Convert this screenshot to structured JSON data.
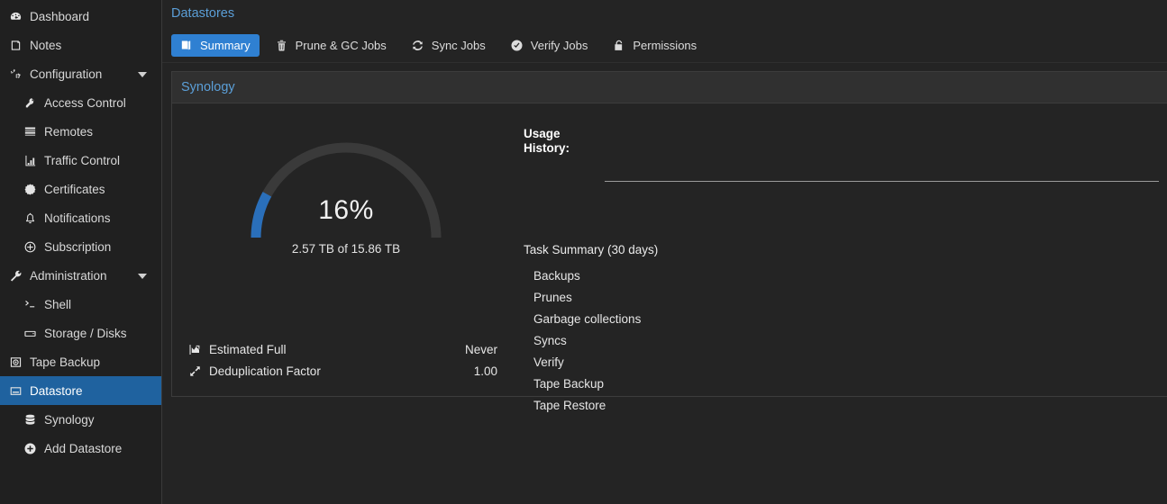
{
  "sidebar": {
    "items": [
      {
        "label": "Dashboard",
        "icon": "gauge-icon",
        "level": 0,
        "selected": false,
        "caret": false
      },
      {
        "label": "Notes",
        "icon": "note-icon",
        "level": 0,
        "selected": false,
        "caret": false
      },
      {
        "label": "Configuration",
        "icon": "gears-icon",
        "level": 0,
        "selected": false,
        "caret": true
      },
      {
        "label": "Access Control",
        "icon": "key-icon",
        "level": 1,
        "selected": false,
        "caret": false
      },
      {
        "label": "Remotes",
        "icon": "server-stack-icon",
        "level": 1,
        "selected": false,
        "caret": false
      },
      {
        "label": "Traffic Control",
        "icon": "traffic-chart-icon",
        "level": 1,
        "selected": false,
        "caret": false
      },
      {
        "label": "Certificates",
        "icon": "certificate-icon",
        "level": 1,
        "selected": false,
        "caret": false
      },
      {
        "label": "Notifications",
        "icon": "bell-icon",
        "level": 1,
        "selected": false,
        "caret": false
      },
      {
        "label": "Subscription",
        "icon": "subscription-icon",
        "level": 1,
        "selected": false,
        "caret": false
      },
      {
        "label": "Administration",
        "icon": "wrench-icon",
        "level": 0,
        "selected": false,
        "caret": true
      },
      {
        "label": "Shell",
        "icon": "terminal-icon",
        "level": 1,
        "selected": false,
        "caret": false
      },
      {
        "label": "Storage / Disks",
        "icon": "hard-disk-icon",
        "level": 1,
        "selected": false,
        "caret": false
      },
      {
        "label": "Tape Backup",
        "icon": "tape-icon",
        "level": 0,
        "selected": false,
        "caret": false
      },
      {
        "label": "Datastore",
        "icon": "datastore-icon",
        "level": 0,
        "selected": true,
        "caret": false
      },
      {
        "label": "Synology",
        "icon": "database-icon",
        "level": 1,
        "selected": false,
        "caret": false
      },
      {
        "label": "Add Datastore",
        "icon": "plus-circle-icon",
        "level": 1,
        "selected": false,
        "caret": false
      }
    ]
  },
  "header": {
    "title": "Datastores"
  },
  "tabs": [
    {
      "label": "Summary",
      "icon": "book-icon",
      "active": true
    },
    {
      "label": "Prune & GC Jobs",
      "icon": "trash-icon",
      "active": false
    },
    {
      "label": "Sync Jobs",
      "icon": "sync-icon",
      "active": false
    },
    {
      "label": "Verify Jobs",
      "icon": "check-circle-icon",
      "active": false
    },
    {
      "label": "Permissions",
      "icon": "unlock-icon",
      "active": false
    }
  ],
  "panel": {
    "title": "Synology",
    "gauge": {
      "percent_label": "16%",
      "percent_value": 16,
      "capacity_label": "2.57 TB of 15.86 TB",
      "used_value": "2.57 TB",
      "total_value": "15.86 TB",
      "fill_color": "#2a6fba",
      "track_color": "#3a3a3a"
    },
    "stats": [
      {
        "icon": "trend-chart-icon",
        "label": "Estimated Full",
        "value": "Never"
      },
      {
        "icon": "dedup-arrow-icon",
        "label": "Deduplication Factor",
        "value": "1.00"
      }
    ],
    "usage": {
      "title": "Usage History:"
    },
    "task_summary": {
      "title": "Task Summary (30 days)",
      "rows": [
        {
          "name": "Backups",
          "value": ""
        },
        {
          "name": "Prunes",
          "value": ""
        },
        {
          "name": "Garbage collections",
          "value": ""
        },
        {
          "name": "Syncs",
          "value": ""
        },
        {
          "name": "Verify",
          "value": ""
        },
        {
          "name": "Tape Backup",
          "value": ""
        },
        {
          "name": "Tape Restore",
          "value": ""
        }
      ]
    }
  },
  "colors": {
    "accent_blue": "#2f80d2",
    "selected_blue": "#1f629f",
    "title_blue": "#5b9fd8",
    "sidebar_bg": "#202020",
    "main_bg": "#242424",
    "panel_head_bg": "#303030"
  }
}
